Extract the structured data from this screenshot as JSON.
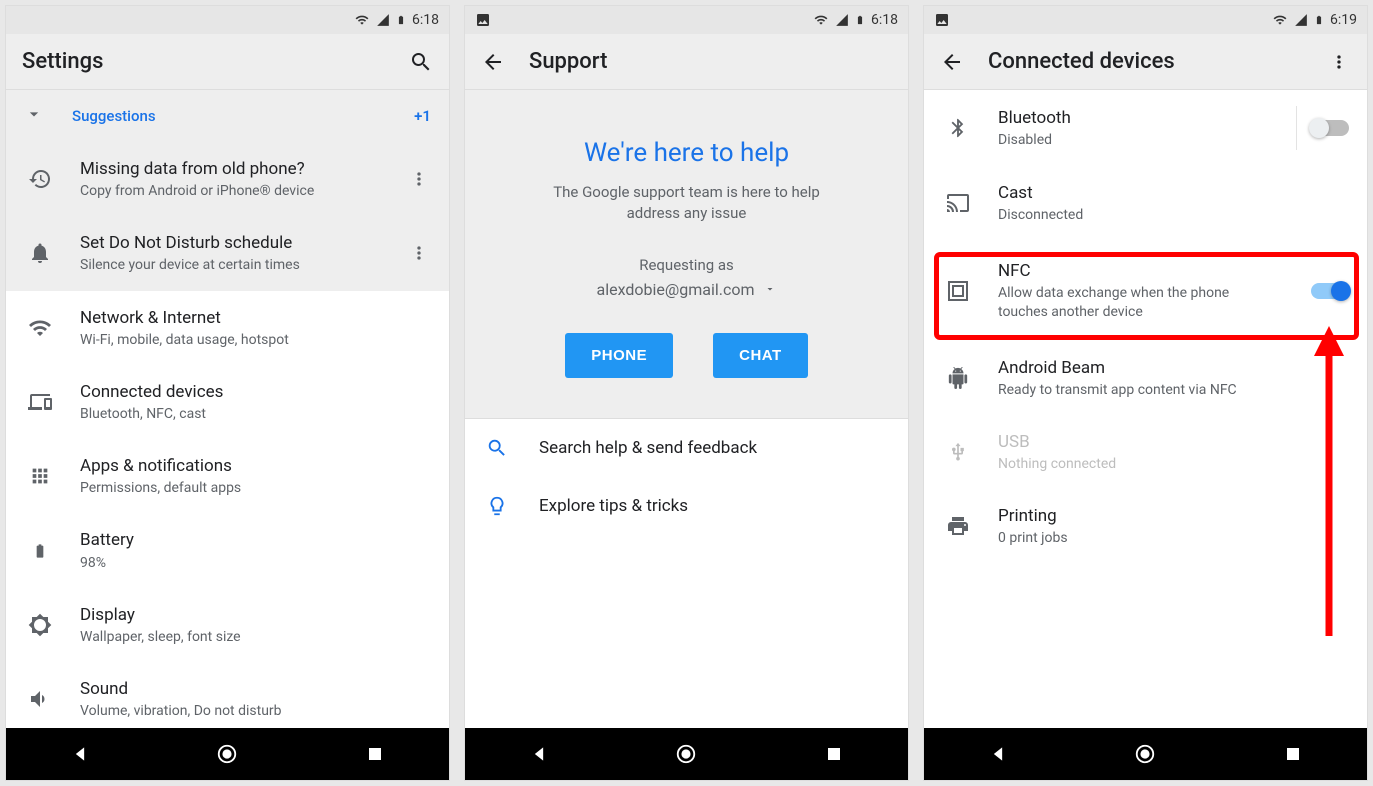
{
  "screens": {
    "settings": {
      "status_time": "6:18",
      "title": "Settings",
      "suggestions_label": "Suggestions",
      "suggestions_count": "+1",
      "items": [
        {
          "title": "Missing data from old phone?",
          "sub": "Copy from Android or iPhone® device"
        },
        {
          "title": "Set Do Not Disturb schedule",
          "sub": "Silence your device at certain times"
        },
        {
          "title": "Network & Internet",
          "sub": "Wi-Fi, mobile, data usage, hotspot"
        },
        {
          "title": "Connected devices",
          "sub": "Bluetooth, NFC, cast"
        },
        {
          "title": "Apps & notifications",
          "sub": "Permissions, default apps"
        },
        {
          "title": "Battery",
          "sub": "98%"
        },
        {
          "title": "Display",
          "sub": "Wallpaper, sleep, font size"
        },
        {
          "title": "Sound",
          "sub": "Volume, vibration, Do not disturb"
        }
      ]
    },
    "support": {
      "status_time": "6:18",
      "title": "Support",
      "headline": "We're here to help",
      "subhead": "The Google support team is here to help address any issue",
      "requesting_label": "Requesting as",
      "requesting_value": "alexdobie@gmail.com",
      "button_phone": "PHONE",
      "button_chat": "CHAT",
      "link_search": "Search help & send feedback",
      "link_tips": "Explore tips & tricks"
    },
    "connected": {
      "status_time": "6:19",
      "title": "Connected devices",
      "items": [
        {
          "title": "Bluetooth",
          "sub": "Disabled"
        },
        {
          "title": "Cast",
          "sub": "Disconnected"
        },
        {
          "title": "NFC",
          "sub": "Allow data exchange when the phone touches another device"
        },
        {
          "title": "Android Beam",
          "sub": "Ready to transmit app content via NFC"
        },
        {
          "title": "USB",
          "sub": "Nothing connected"
        },
        {
          "title": "Printing",
          "sub": "0 print jobs"
        }
      ]
    }
  }
}
